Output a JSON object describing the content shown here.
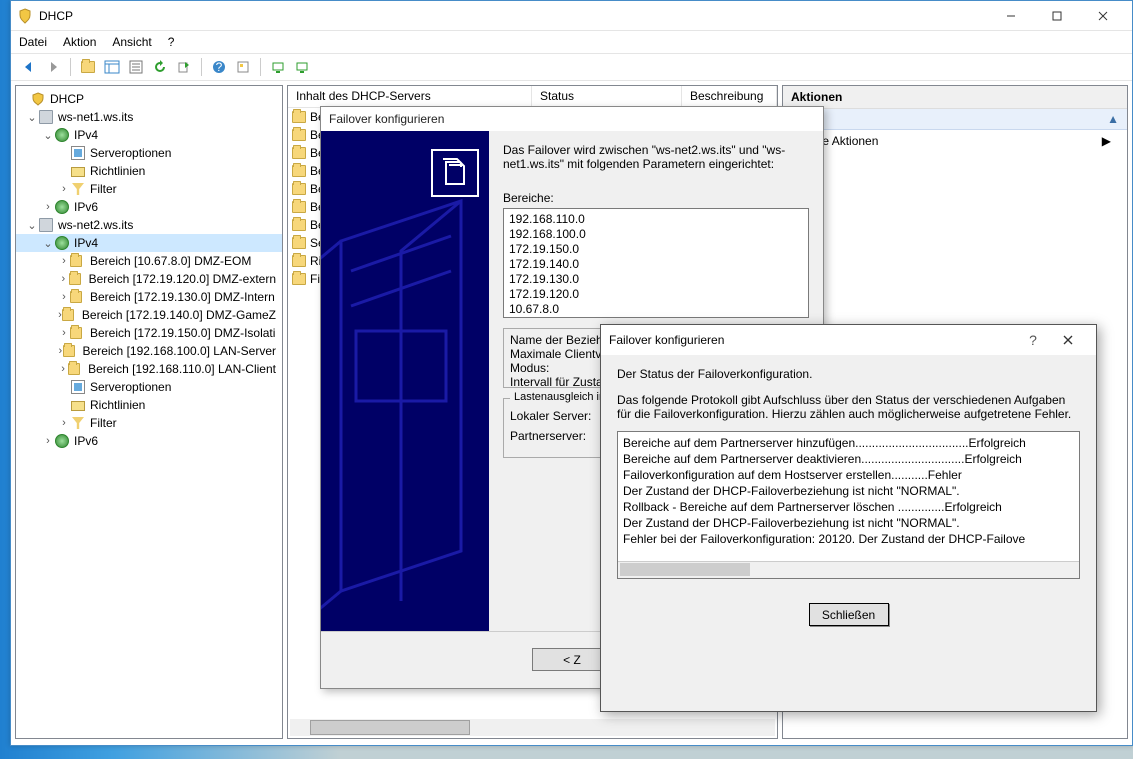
{
  "window": {
    "title": "DHCP"
  },
  "menu": {
    "file": "Datei",
    "action": "Aktion",
    "view": "Ansicht",
    "help": "?"
  },
  "tree": {
    "root": "DHCP",
    "server1": "ws-net1.ws.its",
    "ipv4": "IPv4",
    "serveropts": "Serveroptionen",
    "policies": "Richtlinien",
    "filter": "Filter",
    "ipv6": "IPv6",
    "server2": "ws-net2.ws.its",
    "scopes": [
      "Bereich [10.67.8.0] DMZ-EOM",
      "Bereich [172.19.120.0] DMZ-extern",
      "Bereich [172.19.130.0] DMZ-Intern",
      "Bereich [172.19.140.0] DMZ-GameZ",
      "Bereich [172.19.150.0] DMZ-Isolati",
      "Bereich [192.168.100.0] LAN-Server",
      "Bereich [192.168.110.0] LAN-Client"
    ]
  },
  "list": {
    "col_content": "Inhalt des DHCP-Servers",
    "col_status": "Status",
    "col_desc": "Beschreibung",
    "rows": [
      "Be",
      "Be",
      "Be",
      "Be",
      "Be",
      "Be",
      "Be",
      "Se",
      "Ric",
      "Filt"
    ]
  },
  "actions": {
    "header": "Aktionen",
    "more": "eitere Aktionen"
  },
  "wizard": {
    "title": "Failover konfigurieren",
    "intro": "Das Failover wird zwischen \"ws-net2.ws.its\" und \"ws-net1.ws.its\" mit folgenden Parametern eingerichtet:",
    "scopes_label": "Bereiche:",
    "scopes": [
      "192.168.110.0",
      "192.168.100.0",
      "172.19.150.0",
      "172.19.140.0",
      "172.19.130.0",
      "172.19.120.0",
      "10.67.8.0"
    ],
    "summary": {
      "line1": "Name der Beziehung:",
      "line2": "Maximale Clientvorlau",
      "line3": "Modus:",
      "line4": "Intervall für Zustands-"
    },
    "lb_group": "Lastenausgleich in Pr",
    "local": "Lokaler Server:",
    "partner": "Partnerserver:",
    "back_btn": "< Z"
  },
  "status": {
    "title": "Failover konfigurieren",
    "help": "?",
    "intro1": "Der Status der Failoverkonfiguration.",
    "intro2": "Das folgende Protokoll gibt Aufschluss über den Status der verschiedenen Aufgaben für die Failoverkonfiguration. Hierzu zählen auch möglicherweise aufgetretene Fehler.",
    "log": [
      "Bereiche auf dem Partnerserver hinzufügen..................................Erfolgreich",
      "Bereiche auf dem Partnerserver deaktivieren...............................Erfolgreich",
      "Failoverkonfiguration auf dem Hostserver erstellen...........Fehler",
      "Der Zustand der DHCP-Failoverbeziehung ist nicht \"NORMAL\".",
      "Rollback - Bereiche auf dem Partnerserver löschen ..............Erfolgreich",
      "Der Zustand der DHCP-Failoverbeziehung ist nicht \"NORMAL\".",
      "Fehler bei der Failoverkonfiguration: 20120. Der Zustand der DHCP-Failove"
    ],
    "close": "Schließen"
  }
}
